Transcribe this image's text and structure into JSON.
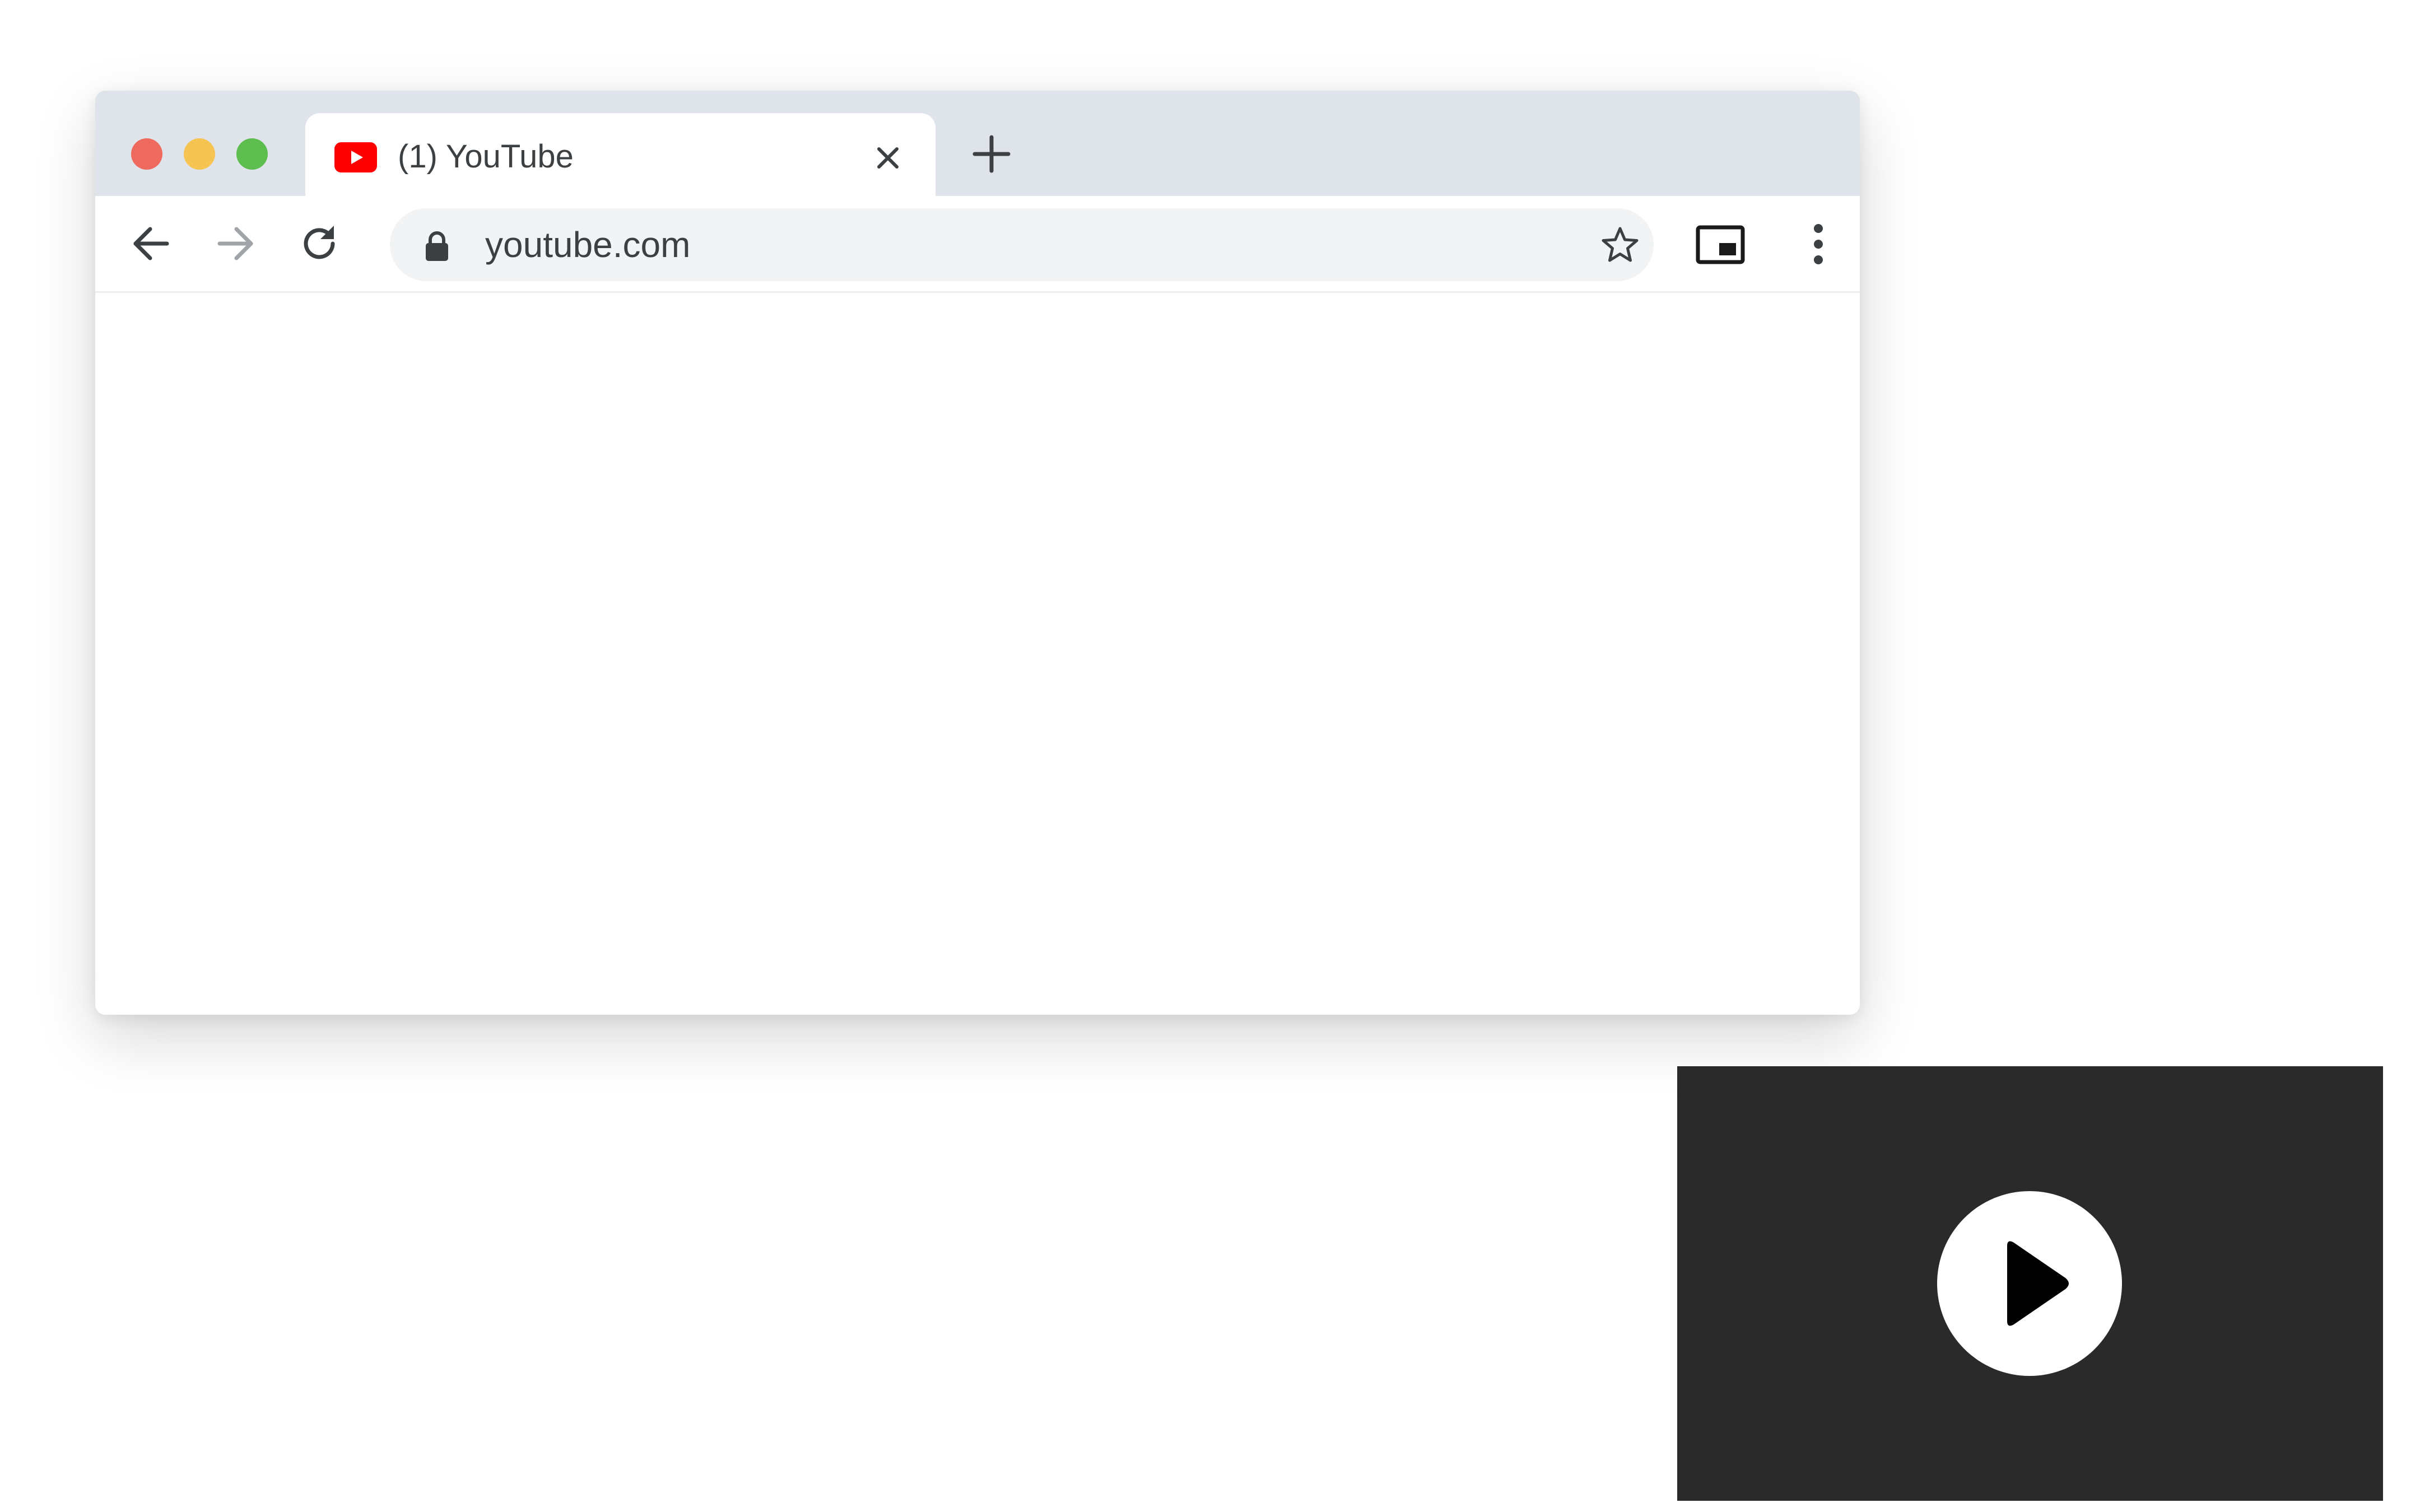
{
  "browser": {
    "tab": {
      "title": "(1) YouTube",
      "favicon": "youtube-logo-icon",
      "close_icon": "close-icon"
    },
    "new_tab_icon": "plus-icon",
    "toolbar": {
      "back_icon": "arrow-left-icon",
      "forward_icon": "arrow-right-icon",
      "reload_icon": "reload-icon",
      "omnibox": {
        "lock_icon": "lock-icon",
        "url": "youtube.com",
        "bookmark_icon": "star-icon"
      },
      "pip_icon": "picture-in-picture-icon",
      "menu_icon": "more-vertical-icon"
    },
    "traffic_lights": [
      "close",
      "minimize",
      "maximize"
    ]
  },
  "pip": {
    "play_icon": "play-icon"
  },
  "colors": {
    "tabstrip": "#dfe3ea",
    "omnibox": "#f1f3f4",
    "youtube_red": "#ff0000",
    "pip_background": "#2a2a2a",
    "traffic_close": "#ee6a5f",
    "traffic_minimize": "#f5c452",
    "traffic_maximize": "#5ebd4f"
  }
}
